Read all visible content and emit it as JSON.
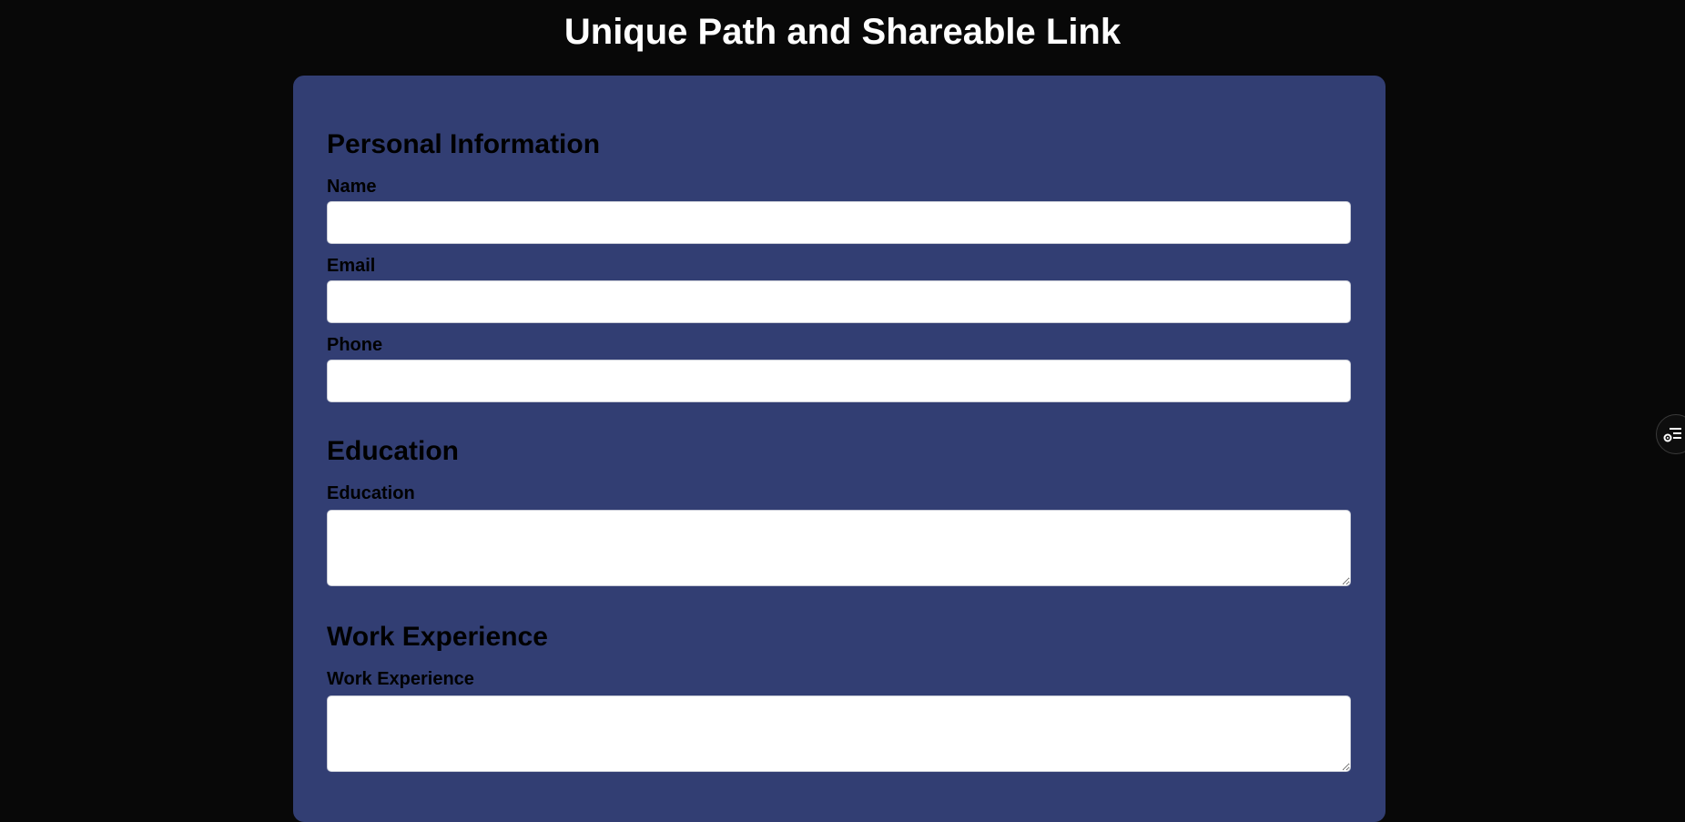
{
  "page": {
    "title": "Unique Path and Shareable Link"
  },
  "colors": {
    "background": "#080808",
    "card": "#323e73",
    "input_background": "#ffffff"
  },
  "form": {
    "personal": {
      "heading": "Personal Information",
      "name_label": "Name",
      "name_value": "",
      "email_label": "Email",
      "email_value": "",
      "phone_label": "Phone",
      "phone_value": ""
    },
    "education": {
      "heading": "Education",
      "field_label": "Education",
      "field_value": ""
    },
    "work": {
      "heading": "Work Experience",
      "field_label": "Work Experience",
      "field_value": ""
    }
  },
  "floating_button": {
    "icon": "list-settings-icon"
  }
}
